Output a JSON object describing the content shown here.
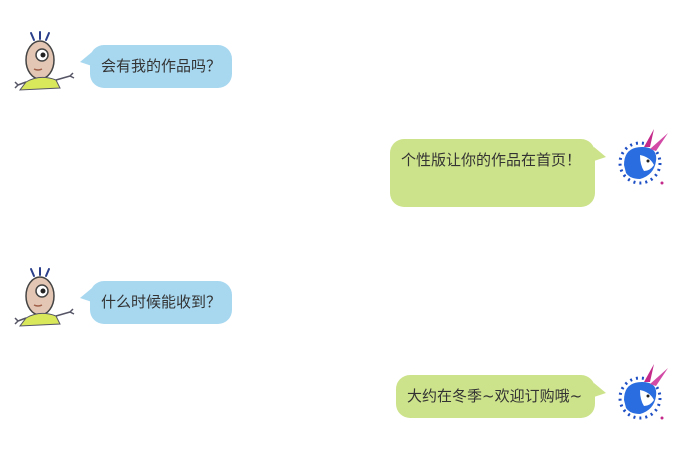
{
  "messages": [
    {
      "side": "left",
      "avatar": "cartoon-boy-avatar-icon",
      "text": "会有我的作品吗？"
    },
    {
      "side": "right",
      "avatar": "blue-rabbit-logo-avatar-icon",
      "text": "个性版让你的作品在首页！"
    },
    {
      "side": "left",
      "avatar": "cartoon-boy-avatar-icon",
      "text": "什么时候能收到？"
    },
    {
      "side": "right",
      "avatar": "blue-rabbit-logo-avatar-icon",
      "text": "大约在冬季~欢迎订购哦~"
    }
  ],
  "colors": {
    "left_bubble": "#a8d8f0",
    "right_bubble": "#cde38b",
    "text": "#333333",
    "background": "#ffffff"
  }
}
